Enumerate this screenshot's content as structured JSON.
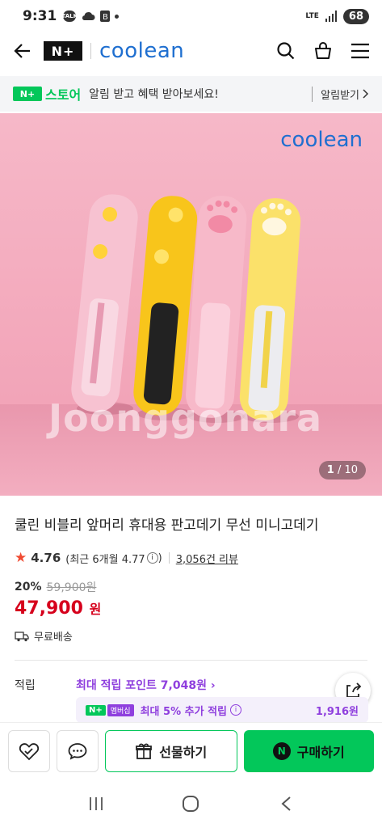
{
  "status": {
    "time": "9:31",
    "talk1": "TALK",
    "lte": "LTE",
    "battery": "68"
  },
  "header": {
    "logo": "N+",
    "brand": "coolean"
  },
  "store": {
    "logo": "N+",
    "logo_text": "스토어",
    "message": "알림 받고 혜택 받아보세요!",
    "alarm_label": "알림받기"
  },
  "photo": {
    "brand": "coolean",
    "watermark": "Joonggonara",
    "counter_current": "1",
    "counter_total": "/ 10"
  },
  "product": {
    "title": "쿨린 비블리 앞머리 휴대용 판고데기 무선 미니고데기",
    "rating": "4.76",
    "recent_rating": "(최근 6개월 4.77",
    "recent_close": ")",
    "review_count": "3,056건 리뷰",
    "discount_pct": "20%",
    "original_price": "59,900원",
    "price": "47,900",
    "price_unit": "원",
    "shipping": "무료배송"
  },
  "points": {
    "label": "적립",
    "max_points": "최대 적립 포인트 7,048원 ›"
  },
  "membership": {
    "badge": "N+",
    "tag": "멤버십",
    "text": "최대 5% 추가 적립",
    "amount": "1,916원"
  },
  "buybar": {
    "gift_label": "선물하기",
    "buy_label": "구매하기",
    "buy_icon": "N"
  },
  "colors": {
    "naver_green": "#03c75a",
    "price_red": "#d6001c",
    "points_purple": "#8f3fde",
    "brand_blue": "#1f6fd0"
  }
}
